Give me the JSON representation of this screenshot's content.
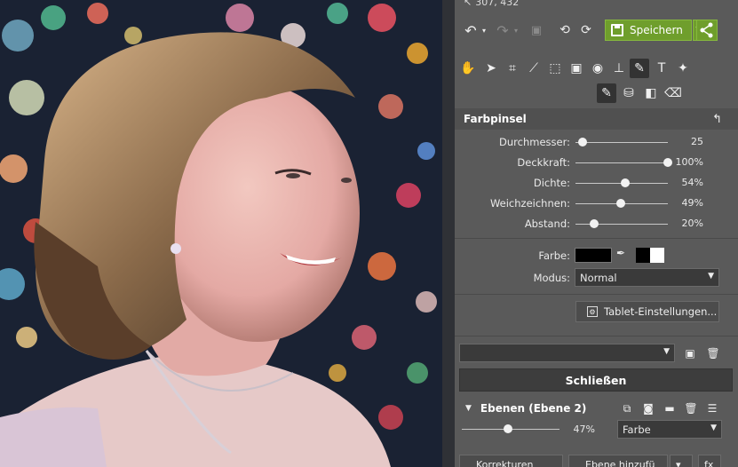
{
  "canvas": {
    "cursor_coords": "307, 432"
  },
  "toolbar": {
    "save_label": "Speichern"
  },
  "tool_panel": {
    "title": "Farbpinsel",
    "sliders": [
      {
        "label": "Durchmesser:",
        "value": "25",
        "level": 0.08
      },
      {
        "label": "Deckkraft:",
        "value": "100%",
        "level": 1.0
      },
      {
        "label": "Dichte:",
        "value": "54%",
        "level": 0.54
      },
      {
        "label": "Weichzeichnen:",
        "value": "49%",
        "level": 0.49
      },
      {
        "label": "Abstand:",
        "value": "20%",
        "level": 0.2
      }
    ],
    "color_label": "Farbe:",
    "mode_label": "Modus:",
    "mode_value": "Normal",
    "tablet_button": "Tablet-Einstellungen...",
    "preset_value": "",
    "close_button": "Schließen"
  },
  "layers": {
    "title": "Ebenen (Ebene 2)",
    "opacity_value": "47%",
    "opacity_level": 0.47,
    "blend_mode": "Farbe",
    "corrections_button": "Korrekturen",
    "add_layer_button": "Ebene hinzufü",
    "fx_button": "fx"
  },
  "colors": {
    "accent_green": "#6f9e2c",
    "panel_bg": "#5a5a5a"
  }
}
